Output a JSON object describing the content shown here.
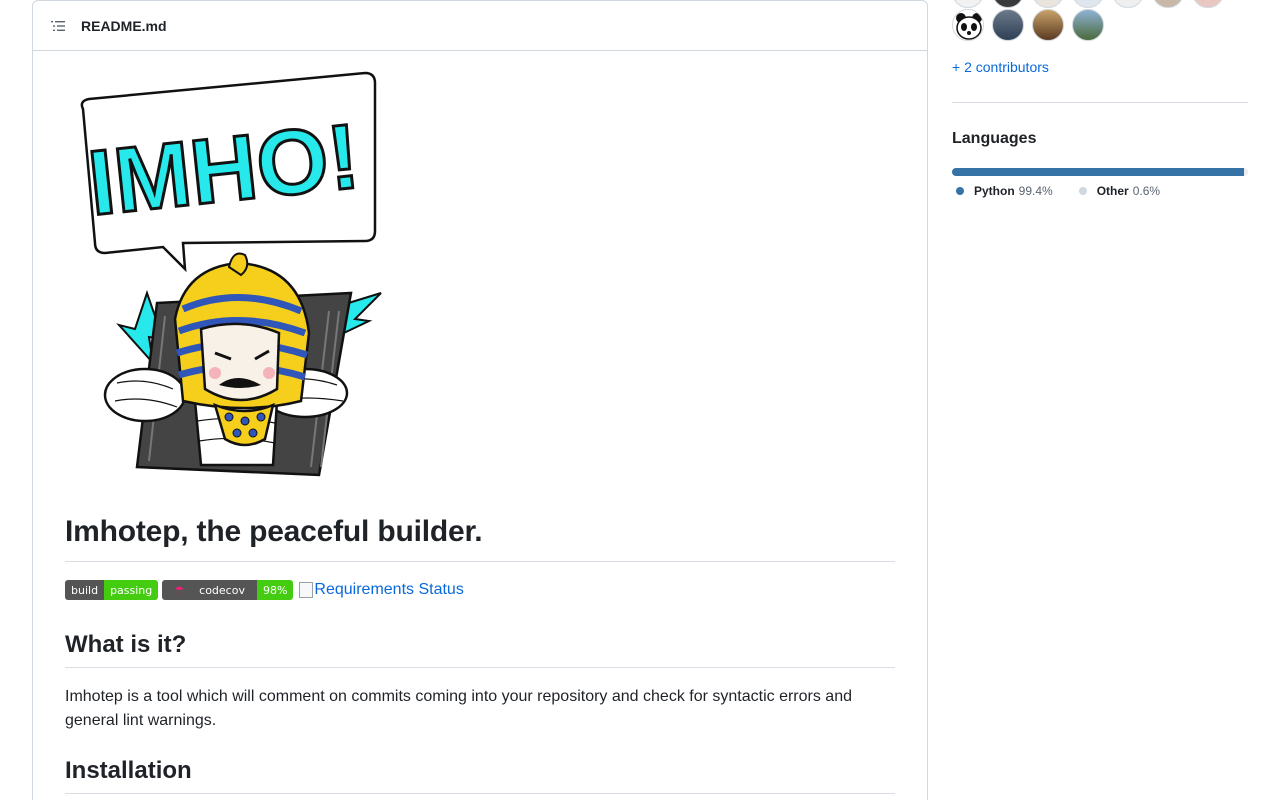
{
  "readme": {
    "filename": "README.md",
    "banner_text": "IMHO!",
    "title": "Imhotep, the peaceful builder.",
    "badges": {
      "build_left": "build",
      "build_right": "passing",
      "codecov_left": "codecov",
      "codecov_right": "98%",
      "requirements_alt": "Requirements Status"
    },
    "what_heading": "What is it?",
    "what_text": "Imhotep is a tool which will comment on commits coming into your repository and check for syntactic errors and general lint warnings.",
    "install_heading": "Installation"
  },
  "sidebar": {
    "contributors_link": "+ 2 contributors",
    "languages_title": "Languages",
    "languages": [
      {
        "name": "Python",
        "percent": "99.4%",
        "value": 99.4,
        "color": "#3572A5"
      },
      {
        "name": "Other",
        "percent": "0.6%",
        "value": 0.6,
        "color": "#ededed"
      }
    ]
  },
  "colors": {
    "link": "#0969da",
    "border": "#d0d7de",
    "badge_green": "#44cc11",
    "badge_grey": "#555555",
    "banner_cyan": "#27e8ea"
  }
}
